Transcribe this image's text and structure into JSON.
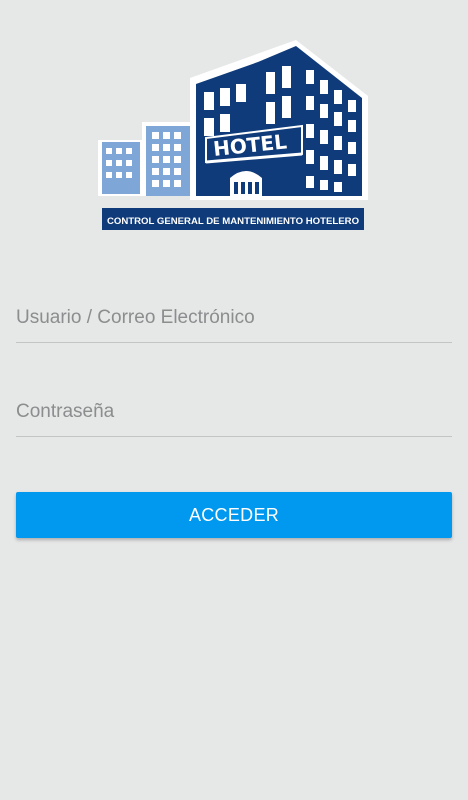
{
  "logo": {
    "hotel_text": "HOTEL",
    "banner_text": "CONTROL GENERAL DE MANTENIMIENTO HOTELERO",
    "colors": {
      "navy": "#0f3b7a",
      "light_blue": "#7ea7d8",
      "white": "#ffffff"
    }
  },
  "form": {
    "username_placeholder": "Usuario / Correo Electrónico",
    "password_placeholder": "Contraseña",
    "submit_label": "ACCEDER"
  },
  "colors": {
    "background": "#e6e7e7",
    "accent": "#0198f0",
    "placeholder": "#8b8d8e",
    "divider": "#c3c5c5"
  }
}
